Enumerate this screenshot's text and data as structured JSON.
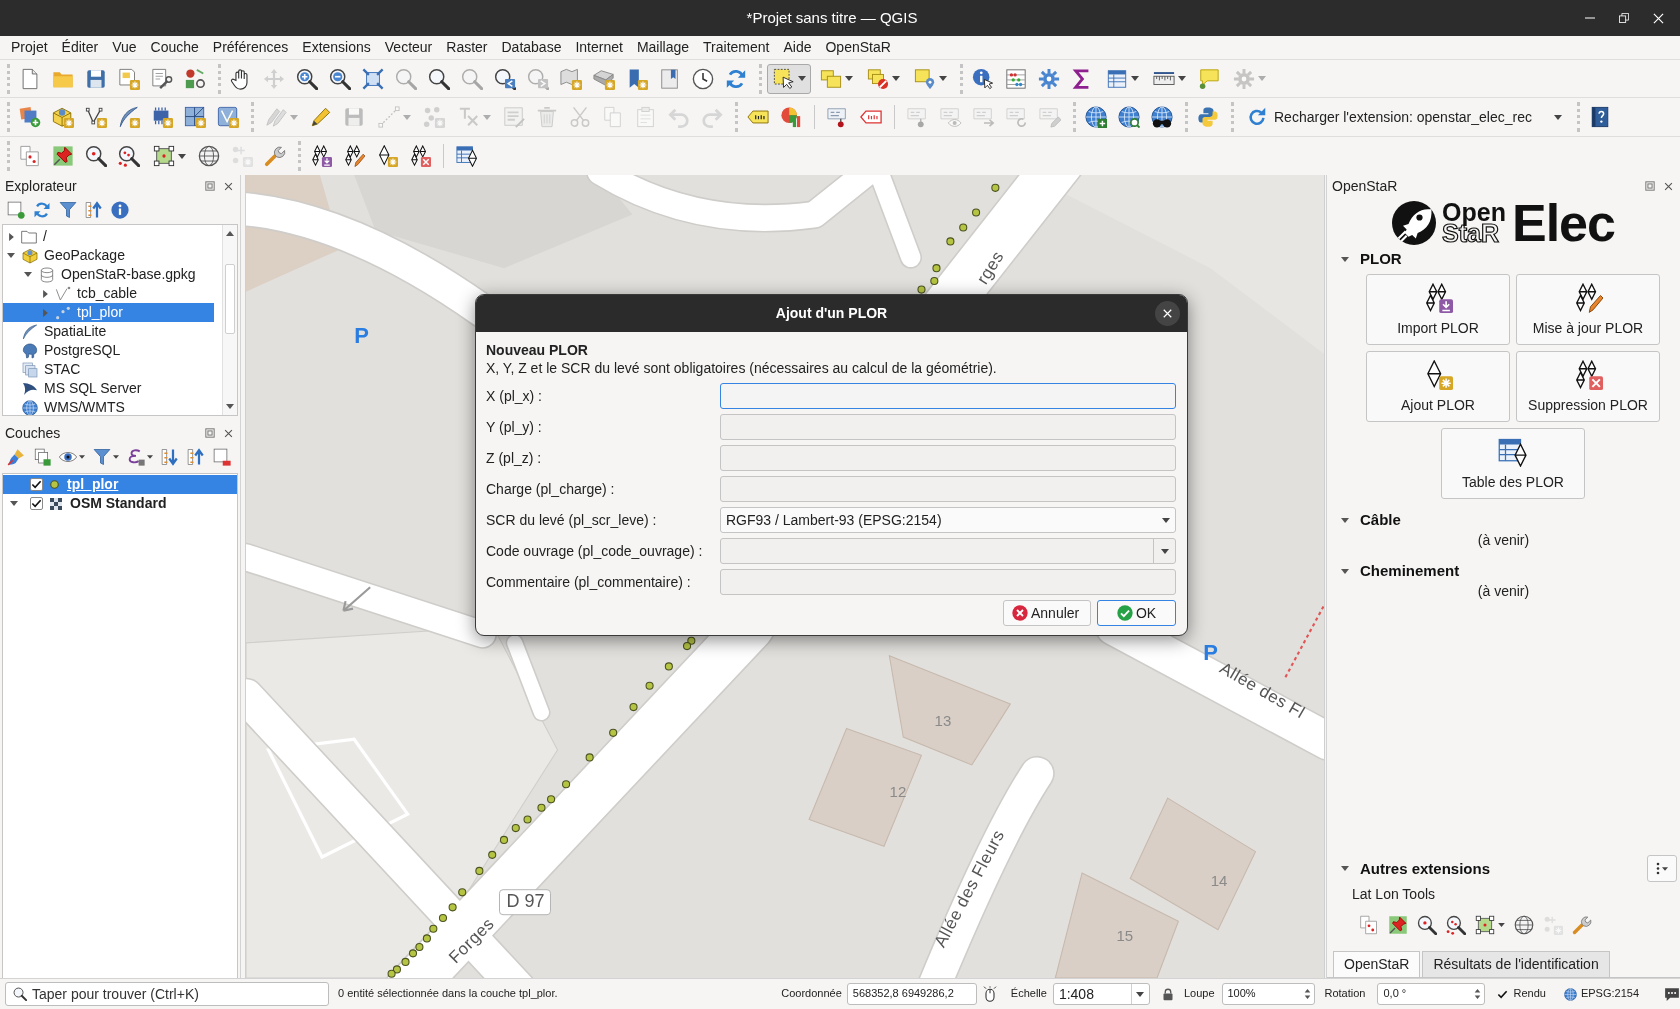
{
  "window": {
    "title": "*Projet sans titre — QGIS"
  },
  "menu_bar": [
    "Projet",
    "Éditer",
    "Vue",
    "Couche",
    "Préférences",
    "Extensions",
    "Vecteur",
    "Raster",
    "Database",
    "Internet",
    "Maillage",
    "Traitement",
    "Aide",
    "OpenStaR"
  ],
  "toolbars": [
    [
      [
        {
          "disabled": false,
          "pressed": false
        },
        {
          "disabled": false,
          "pressed": false
        },
        {
          "disabled": false,
          "pressed": false
        },
        {
          "disabled": false,
          "pressed": false
        },
        {
          "disabled": false,
          "pressed": false
        },
        {
          "disabled": false,
          "pressed": false
        }
      ],
      [
        {
          "disabled": false,
          "pressed": false
        },
        {
          "disabled": true,
          "pressed": false
        },
        {
          "disabled": false,
          "pressed": false
        },
        {
          "disabled": false,
          "pressed": false
        },
        {
          "disabled": false,
          "pressed": false
        },
        {
          "disabled": true,
          "pressed": false
        },
        {
          "disabled": false,
          "pressed": false
        },
        {
          "disabled": true,
          "pressed": false
        },
        {
          "disabled": false,
          "pressed": false
        },
        {
          "disabled": true,
          "pressed": false
        },
        {
          "disabled": false,
          "pressed": false
        },
        {
          "disabled": false,
          "pressed": false
        },
        {
          "disabled": false,
          "pressed": false
        },
        {
          "disabled": false,
          "pressed": false
        },
        {
          "disabled": false,
          "pressed": false
        },
        {
          "disabled": false,
          "pressed": false
        }
      ],
      [
        {
          "disabled": false,
          "pressed": true
        },
        {
          "disabled": false,
          "pressed": false
        },
        {
          "disabled": false,
          "pressed": false
        },
        {
          "disabled": false,
          "pressed": false
        }
      ],
      [
        {
          "disabled": false,
          "pressed": false
        },
        {
          "disabled": false,
          "pressed": false
        },
        {
          "disabled": false,
          "pressed": false
        },
        {
          "disabled": false,
          "pressed": false
        },
        {
          "disabled": false,
          "pressed": false
        },
        {
          "disabled": false,
          "pressed": false
        },
        {
          "disabled": false,
          "pressed": false
        },
        {
          "disabled": true,
          "pressed": false
        }
      ]
    ],
    [
      [
        {
          "disabled": false,
          "pressed": false
        },
        {
          "disabled": false,
          "pressed": false
        },
        {
          "disabled": false,
          "pressed": false
        },
        {
          "disabled": false,
          "pressed": false
        },
        {
          "disabled": false,
          "pressed": false
        },
        {
          "disabled": false,
          "pressed": false
        },
        {
          "disabled": false,
          "pressed": false
        }
      ],
      [
        {
          "disabled": true,
          "pressed": false
        },
        {
          "disabled": false,
          "pressed": false
        },
        {
          "disabled": true,
          "pressed": false
        },
        {
          "disabled": true,
          "pressed": false
        },
        {
          "disabled": true,
          "pressed": false
        },
        {
          "disabled": true,
          "pressed": false
        },
        {
          "disabled": true,
          "pressed": false
        },
        {
          "disabled": true,
          "pressed": false
        },
        {
          "disabled": true,
          "pressed": false
        },
        {
          "disabled": true,
          "pressed": false
        },
        {
          "disabled": true,
          "pressed": false
        },
        {
          "disabled": true,
          "pressed": false
        },
        {
          "disabled": true,
          "pressed": false
        }
      ],
      [
        {
          "disabled": false,
          "pressed": false
        },
        {
          "disabled": false,
          "pressed": false
        },
        {
          "disabled": false,
          "pressed": false
        },
        {
          "disabled": false,
          "pressed": false
        },
        {
          "disabled": true,
          "pressed": false
        },
        {
          "disabled": true,
          "pressed": false
        },
        {
          "disabled": true,
          "pressed": false
        },
        {
          "disabled": true,
          "pressed": false
        },
        {
          "disabled": true,
          "pressed": false
        }
      ],
      [
        {
          "disabled": false,
          "pressed": false
        },
        {
          "disabled": false,
          "pressed": false
        },
        {
          "disabled": false,
          "pressed": false
        }
      ],
      [
        {
          "disabled": false,
          "pressed": false
        }
      ],
      [
        {
          "label": "Recharger l'extension: openstar_elec_rec",
          "disabled": false,
          "pressed": false
        }
      ],
      [
        {
          "disabled": false,
          "pressed": false
        }
      ]
    ],
    [
      [
        {
          "disabled": false,
          "pressed": false
        },
        {
          "disabled": false,
          "pressed": false
        },
        {
          "disabled": false,
          "pressed": false
        },
        {
          "disabled": false,
          "pressed": false
        },
        {
          "disabled": false,
          "pressed": false
        },
        {
          "disabled": false,
          "pressed": false
        },
        {
          "disabled": true,
          "pressed": false
        },
        {
          "disabled": false,
          "pressed": false
        }
      ],
      [
        {
          "disabled": false,
          "pressed": false
        },
        {
          "disabled": false,
          "pressed": false
        },
        {
          "disabled": false,
          "pressed": false
        },
        {
          "disabled": false,
          "pressed": false
        },
        {
          "disabled": false,
          "pressed": false
        }
      ]
    ]
  ],
  "explorer_panel": {
    "title": "Explorateur",
    "tree": [
      {
        "label": "/",
        "kind": "folder",
        "expanded": false,
        "selected": false
      },
      {
        "label": "GeoPackage",
        "kind": "geopackage",
        "expanded": true,
        "selected": false,
        "children": [
          {
            "label": "OpenStaR-base.gpkg",
            "kind": "database",
            "expanded": true,
            "selected": false,
            "children": [
              {
                "label": "tcb_cable",
                "kind": "line_layer",
                "expanded": false,
                "selected": false
              },
              {
                "label": "tpl_plor",
                "kind": "point_layer",
                "expanded": false,
                "selected": true
              }
            ]
          }
        ]
      },
      {
        "label": "SpatiaLite",
        "kind": "spatialite",
        "selected": false
      },
      {
        "label": "PostgreSQL",
        "kind": "postgresql",
        "selected": false
      },
      {
        "label": "STAC",
        "kind": "stac",
        "selected": false
      },
      {
        "label": "MS SQL Server",
        "kind": "mssql",
        "selected": false
      },
      {
        "label": "WMS/WMTS",
        "kind": "wms",
        "selected": false
      }
    ]
  },
  "layers_panel": {
    "title": "Couches",
    "layers": [
      {
        "label": "tpl_plor",
        "kind": "point",
        "checked": true,
        "selected": true
      },
      {
        "label": "OSM Standard",
        "kind": "raster",
        "checked": true,
        "selected": false,
        "expanded": true
      }
    ]
  },
  "map": {
    "labels": [
      {
        "kind": "street",
        "text": "rges"
      },
      {
        "kind": "parking",
        "text": "P"
      },
      {
        "kind": "parking",
        "text": "P"
      },
      {
        "kind": "street",
        "text": "Allée des Fl"
      },
      {
        "kind": "house_number",
        "text": "13"
      },
      {
        "kind": "house_number",
        "text": "12"
      },
      {
        "kind": "house_number",
        "text": "14"
      },
      {
        "kind": "house_number",
        "text": "15"
      },
      {
        "kind": "road_ref",
        "text": "D 97"
      },
      {
        "kind": "street",
        "text": "Allée des Fleurs"
      },
      {
        "kind": "street",
        "text": "Forges"
      }
    ]
  },
  "dialog": {
    "title": "Ajout d'un PLOR",
    "heading": "Nouveau PLOR",
    "description": "X, Y, Z et le SCR du levé sont obligatoires (nécessaires au calcul de la géométrie).",
    "fields": [
      {
        "label": "X (pl_x) :",
        "kind": "text",
        "focused": true
      },
      {
        "label": "Y (pl_y) :",
        "kind": "text",
        "focused": false
      },
      {
        "label": "Z (pl_z) :",
        "kind": "text",
        "focused": false
      },
      {
        "label": "Charge (pl_charge) :",
        "kind": "text",
        "focused": false
      },
      {
        "label": "SCR du levé (pl_scr_leve) :",
        "kind": "select",
        "value": "RGF93 / Lambert-93 (EPSG:2154)",
        "focused": false
      },
      {
        "label": "Code ouvrage (pl_code_ouvrage) :",
        "kind": "combo",
        "focused": false
      },
      {
        "label": "Commentaire (pl_commentaire) :",
        "kind": "text",
        "focused": false
      }
    ],
    "buttons": [
      {
        "label": "Annuler",
        "kind": "cancel",
        "default": false
      },
      {
        "label": "OK",
        "kind": "ok",
        "default": true
      }
    ]
  },
  "openstar_panel": {
    "title": "OpenStaR",
    "logo": {
      "open": "Open",
      "star": "StaR",
      "elec": "Elec"
    },
    "sections": [
      {
        "title": "PLOR",
        "expanded": true,
        "buttons": [
          {
            "label": "Import PLOR"
          },
          {
            "label": "Mise à jour PLOR"
          },
          {
            "label": "Ajout PLOR"
          },
          {
            "label": "Suppression PLOR"
          },
          {
            "label": "Table des PLOR"
          }
        ]
      },
      {
        "title": "Câble",
        "expanded": true,
        "note": "(à venir)"
      },
      {
        "title": "Cheminement",
        "expanded": true,
        "note": "(à venir)"
      }
    ],
    "other": {
      "title": "Autres extensions",
      "expanded": true,
      "tool_name": "Lat Lon Tools",
      "tools": [
        {
          "disabled": false
        },
        {
          "disabled": false
        },
        {
          "disabled": false
        },
        {
          "disabled": false
        },
        {
          "disabled": false
        },
        {
          "disabled": false
        },
        {
          "disabled": true
        },
        {
          "disabled": false
        }
      ]
    },
    "tabs": [
      {
        "label": "OpenStaR",
        "selected": true
      },
      {
        "label": "Résultats de l'identification",
        "selected": false
      }
    ]
  },
  "status_bar": {
    "search": {
      "placeholder": "Taper pour trouver (Ctrl+K)"
    },
    "message": "0 entité sélectionnée dans la couche tpl_plor.",
    "coordinate": {
      "label": "Coordonnée",
      "value": "568352,8 6949286,2"
    },
    "scale": {
      "label": "Échelle",
      "value": "1:408"
    },
    "magnifier": {
      "label": "Loupe",
      "value": "100%"
    },
    "rotation": {
      "label": "Rotation",
      "value": "0,0 °"
    },
    "render": {
      "label": "Rendu",
      "checked": true
    },
    "crs": "EPSG:2154"
  }
}
